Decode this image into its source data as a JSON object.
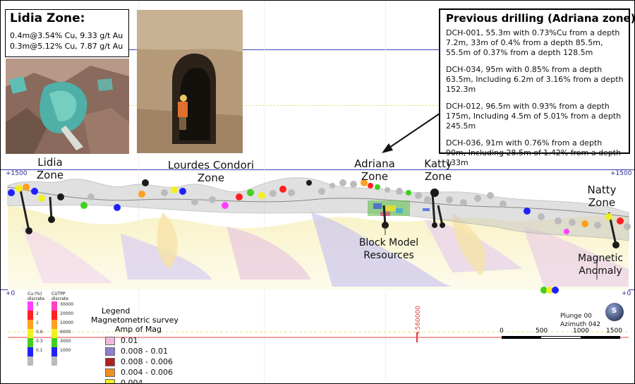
{
  "lidia_box": {
    "title": "Lidia Zone:",
    "line1": "0.4m@3.54% Cu, 9.33 g/t Au",
    "line2": "0.3m@5.12% Cu, 7.87 g/t Au"
  },
  "drilling_box": {
    "title": "Previous drilling (Adriana zone):",
    "entries": [
      "DCH-001, 55.3m with 0.73%Cu from a depth 7.2m, 33m of 0.4% from a depth 85.5m, 55.5m of 0.37% from a depth 128.5m",
      "DCH-034, 95m with 0.85% from a depth 63.5m, Including 6.2m of 3.16% from a depth 152.3m",
      "DCH-012, 96.5m with 0.93% from a depth 175m, Including 4.5m of 5.01% from  a depth 245.5m",
      "DCH-036, 91m with 0.76% from a depth 90m, Including 28.5m of 1.42% from a depth 133m"
    ]
  },
  "zone_labels": {
    "lidia": "Lidia\nZone",
    "lourdes": "Lourdes Condori\nZone",
    "adriana": "Adriana\nZone",
    "katty": "Katty\nZone",
    "natty": "Natty\nZone",
    "block_model": "Block Model\nResources",
    "magnetic": "Magnetic\nAnomaly"
  },
  "elevations": {
    "top_left": "+1500",
    "top_right": "+1500",
    "zero_left": "+0",
    "zero_right": "+0"
  },
  "easting": "+560000",
  "legend": {
    "title": "Legend",
    "subtitle": "Magnetometric survey",
    "subtitle2": "Amp of Mag",
    "items": [
      {
        "label": "0.01",
        "color": "#f0b8d8"
      },
      {
        "label": "0.008 - 0.01",
        "color": "#8f7fd0"
      },
      {
        "label": "0.008 - 0.006",
        "color": "#b02020"
      },
      {
        "label": "0.004 - 0.006",
        "color": "#f09020"
      },
      {
        "label": "0.004",
        "color": "#f4f020"
      }
    ]
  },
  "cu_scale": {
    "title": "Cu (%)\ndiscrete",
    "values": [
      "3",
      "2",
      "1",
      "0.6",
      "0.3",
      "0.1",
      ""
    ],
    "colors": [
      "#ff40ff",
      "#ff2020",
      "#ffa020",
      "#f0f020",
      "#40d020",
      "#2020ff",
      "#bbbbbb"
    ]
  },
  "cutpp_scale": {
    "title": "CUTPP\ndiscrete",
    "values": [
      "30000",
      "20000",
      "10000",
      "6000",
      "3000",
      "1000",
      ""
    ],
    "colors": [
      "#ff40c0",
      "#ff2020",
      "#ffa020",
      "#f0f020",
      "#40d020",
      "#2020ff",
      "#bbbbbb"
    ]
  },
  "orientation": {
    "plunge": "Plunge 00",
    "azimuth": "Azimuth 042"
  },
  "scalebar": {
    "labels": [
      "0",
      "500",
      "1000",
      "1500"
    ]
  },
  "compass_letter": "S"
}
